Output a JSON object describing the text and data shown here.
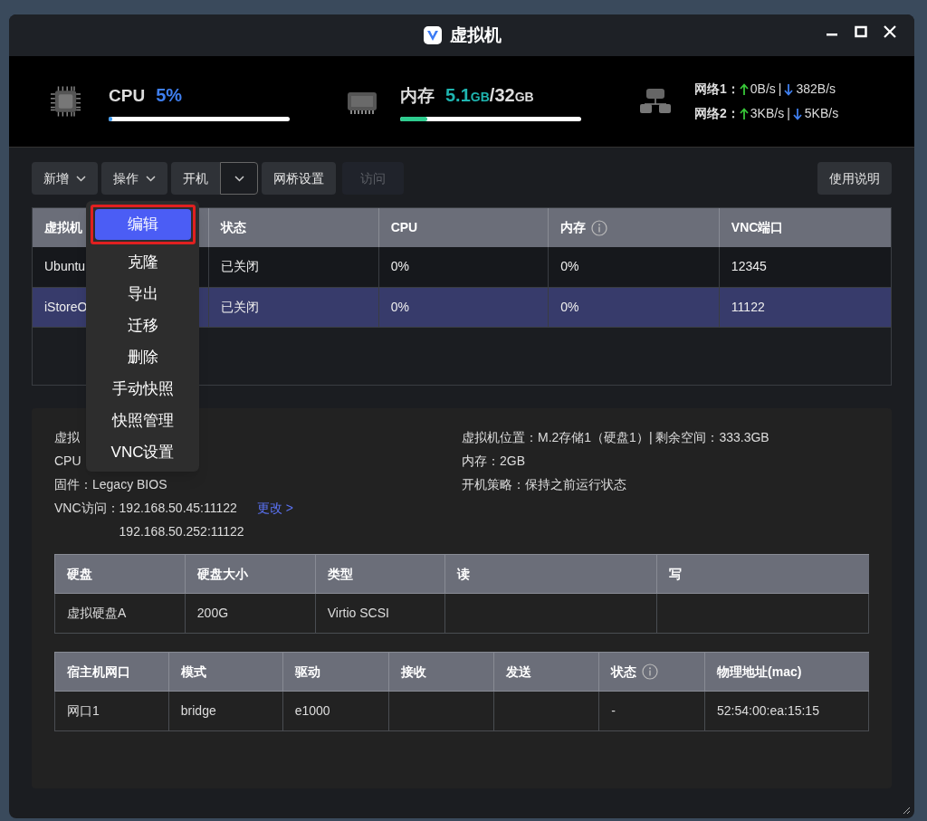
{
  "window": {
    "title": "虚拟机"
  },
  "stats": {
    "cpu": {
      "label": "CPU",
      "value": "5%",
      "level": 0.02
    },
    "memory": {
      "label": "内存",
      "used": "5.1",
      "used_unit": "GB",
      "separator": "/",
      "total": "32",
      "total_unit": "GB",
      "level": 0.15
    },
    "network": [
      {
        "label": "网络1：",
        "up": "0B/s",
        "divider": "|",
        "down": "382B/s"
      },
      {
        "label": "网络2：",
        "up": "3KB/s",
        "divider": "|",
        "down": "5KB/s"
      }
    ]
  },
  "toolbar": [
    {
      "kind": "dropdown",
      "label": "新增"
    },
    {
      "kind": "dropdown",
      "label": "操作"
    },
    {
      "kind": "split",
      "label": "开机"
    },
    {
      "kind": "plain",
      "label": "网桥设置"
    },
    {
      "kind": "disabled",
      "label": "访问"
    }
  ],
  "help_button": "使用说明",
  "action_menu": [
    {
      "label": "编辑",
      "selected": true
    },
    {
      "label": "克隆",
      "selected": false
    },
    {
      "label": "导出",
      "selected": false
    },
    {
      "label": "迁移",
      "selected": false
    },
    {
      "label": "删除",
      "selected": false
    },
    {
      "label": "手动快照",
      "selected": false
    },
    {
      "label": "快照管理",
      "selected": false
    },
    {
      "label": "VNC设置",
      "selected": false
    }
  ],
  "vm_table": {
    "columns": [
      {
        "label": "虚拟机",
        "info": false
      },
      {
        "label": "状态",
        "info": false
      },
      {
        "label": "CPU",
        "info": false
      },
      {
        "label": "内存",
        "info": true
      },
      {
        "label": "VNC端口",
        "info": false
      }
    ],
    "rows": [
      {
        "selected": false,
        "cells": [
          "Ubuntu",
          "已关闭",
          "0%",
          "0%",
          "12345"
        ]
      },
      {
        "selected": true,
        "cells": [
          "iStoreO",
          "已关闭",
          "0%",
          "0%",
          "11122"
        ]
      }
    ]
  },
  "details": {
    "left": [
      "虚拟",
      "CPU",
      "固件：Legacy BIOS"
    ],
    "vnc": {
      "label": "VNC访问：",
      "addresses": [
        "192.168.50.45:11122",
        "192.168.50.252:11122"
      ],
      "link": "更改 >"
    },
    "right": [
      "虚拟机位置：M.2存储1（硬盘1）| 剩余空间：333.3GB",
      "内存：2GB",
      "开机策略：保持之前运行状态"
    ],
    "disk_table": {
      "columns": [
        {
          "label": "硬盘",
          "info": false
        },
        {
          "label": "硬盘大小",
          "info": false
        },
        {
          "label": "类型",
          "info": false
        },
        {
          "label": "读",
          "info": false
        },
        {
          "label": "写",
          "info": false
        }
      ],
      "rows": [
        [
          "虚拟硬盘A",
          "200G",
          "Virtio SCSI",
          "",
          ""
        ]
      ]
    },
    "nic_table": {
      "columns": [
        {
          "label": "宿主机网口",
          "info": false
        },
        {
          "label": "模式",
          "info": false
        },
        {
          "label": "驱动",
          "info": false
        },
        {
          "label": "接收",
          "info": false
        },
        {
          "label": "发送",
          "info": false
        },
        {
          "label": "状态",
          "info": true
        },
        {
          "label": "物理地址(mac)",
          "info": false
        }
      ],
      "rows": [
        [
          "网口1",
          "bridge",
          "e1000",
          "",
          "",
          "-",
          "52:54:00:ea:15:15"
        ]
      ]
    }
  }
}
